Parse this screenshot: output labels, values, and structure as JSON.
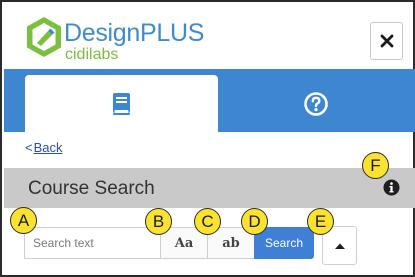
{
  "header": {
    "brand_name": "DesignPLUS",
    "brand_sub": "cidilabs",
    "close_glyph": "✕"
  },
  "tabs": [
    {
      "icon": "book-icon",
      "active": true
    },
    {
      "icon": "help-circle-icon",
      "active": false
    }
  ],
  "nav": {
    "back_label": "Back",
    "back_chevron": "<"
  },
  "panel": {
    "title": "Course Search"
  },
  "search": {
    "placeholder": "Search text",
    "case_label": "Aa",
    "word_label": "ab",
    "search_label": "Search"
  },
  "callouts": {
    "a": "A",
    "b": "B",
    "c": "C",
    "d": "D",
    "e": "E",
    "f": "F"
  },
  "colors": {
    "brand_blue": "#3e8ccd",
    "brand_green": "#7bbf3f",
    "tabbar_blue": "#3f86d1",
    "search_button": "#3f7fd6",
    "title_bar_gray": "#c9c9c9",
    "callout_yellow": "#fbe22f"
  }
}
